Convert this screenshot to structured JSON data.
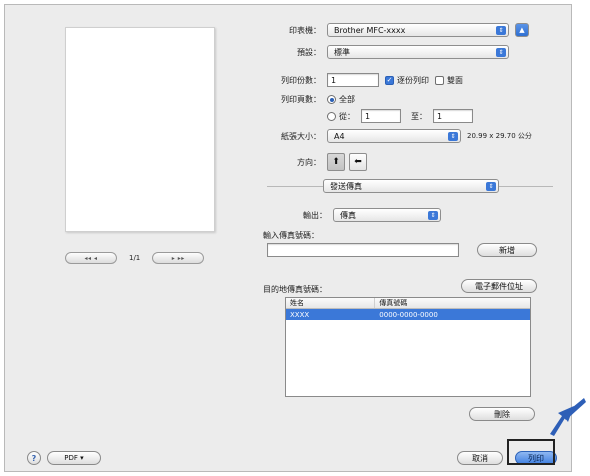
{
  "header": {
    "printer_label": "印表機：",
    "printer_value": "Brother MFC-xxxx",
    "presets_label": "預設：",
    "presets_value": "標準"
  },
  "copies": {
    "label": "列印份數：",
    "value": "1",
    "collated_label": "逐份列印",
    "collated_checked": true,
    "duplex_label": "雙面",
    "duplex_checked": false
  },
  "pages": {
    "label": "列印頁數：",
    "all_label": "全部",
    "from_label": "從：",
    "from_value": "1",
    "to_label": "至：",
    "to_value": "1"
  },
  "paper": {
    "label": "紙張大小：",
    "value": "A4",
    "dims": "20.99 x 29.70 公分"
  },
  "orientation": {
    "label": "方向："
  },
  "section": {
    "value": "發送傳真"
  },
  "fax": {
    "output_label": "輸出：",
    "output_value": "傳真",
    "input_label": "輸入傳真號碼：",
    "input_value": "",
    "add_button": "新增",
    "dest_label": "目的地傳真號碼：",
    "address_book_button": "電子郵件位址",
    "columns": [
      "姓名",
      "傳真號碼"
    ],
    "rows": [
      {
        "name": "XXXX",
        "number": "0000-0000-0000"
      }
    ],
    "delete_button": "刪除"
  },
  "preview": {
    "first": "◂◂ ◂",
    "page_indicator": "1/1",
    "next": "▸ ▸▸"
  },
  "footer": {
    "help": "?",
    "pdf_button": "PDF ▾",
    "cancel_button": "取消",
    "print_button": "列印"
  },
  "colors": {
    "accent": "#3b78d8",
    "dialog_bg": "#ececec",
    "arrow": "#2e5fb7"
  }
}
